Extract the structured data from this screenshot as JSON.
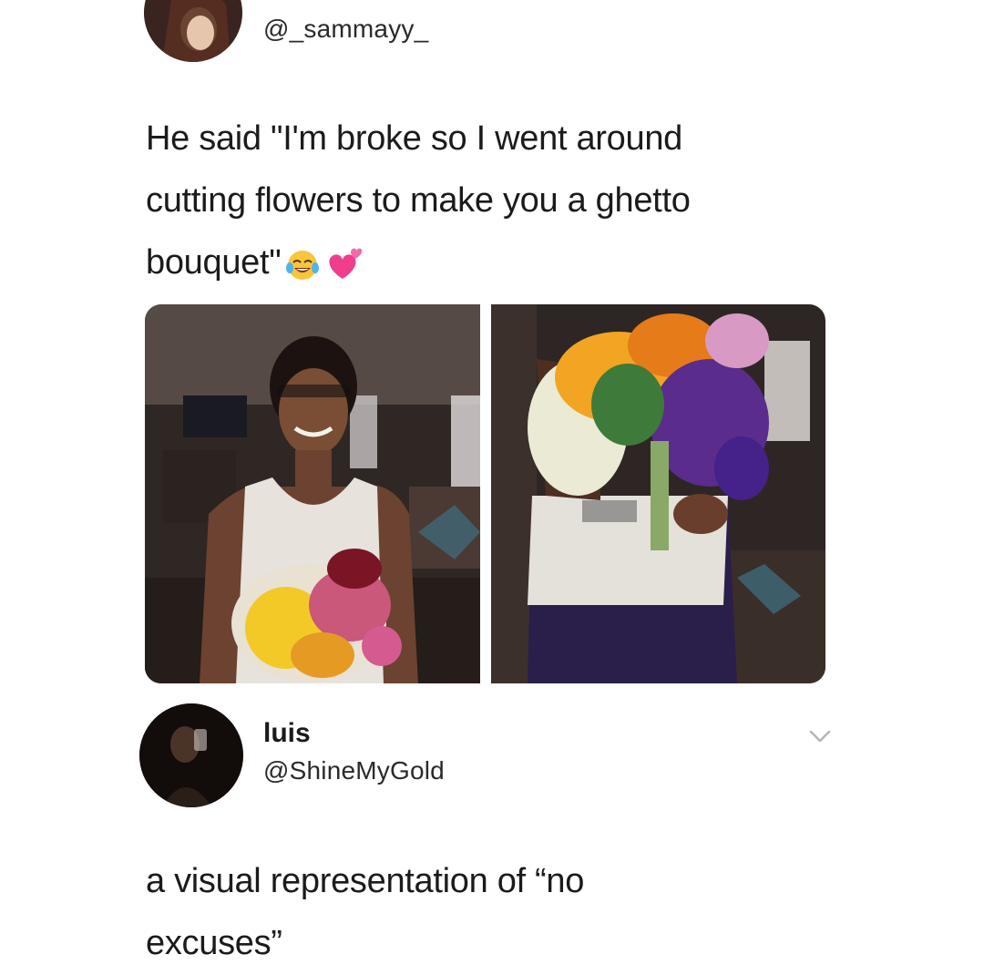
{
  "tweet": {
    "author_handle": "@_sammayy_",
    "text_line1": "He said \"I'm broke so I went around",
    "text_line2": "cutting flowers to make you a ghetto",
    "text_line3": "bouquet\"",
    "emojis": [
      "face-with-tears-of-joy",
      "two-hearts"
    ]
  },
  "reply": {
    "author_name": "luis",
    "author_handle": "@ShineMyGold",
    "text_line1": "a visual representation of “no",
    "text_line2": "excuses”"
  },
  "icons": {
    "more_options": "chevron-down-icon"
  },
  "colors": {
    "background": "#ffffff",
    "text": "#1b1b1b",
    "handle": "#2a2a2a",
    "chevron": "#b5b5b5"
  }
}
